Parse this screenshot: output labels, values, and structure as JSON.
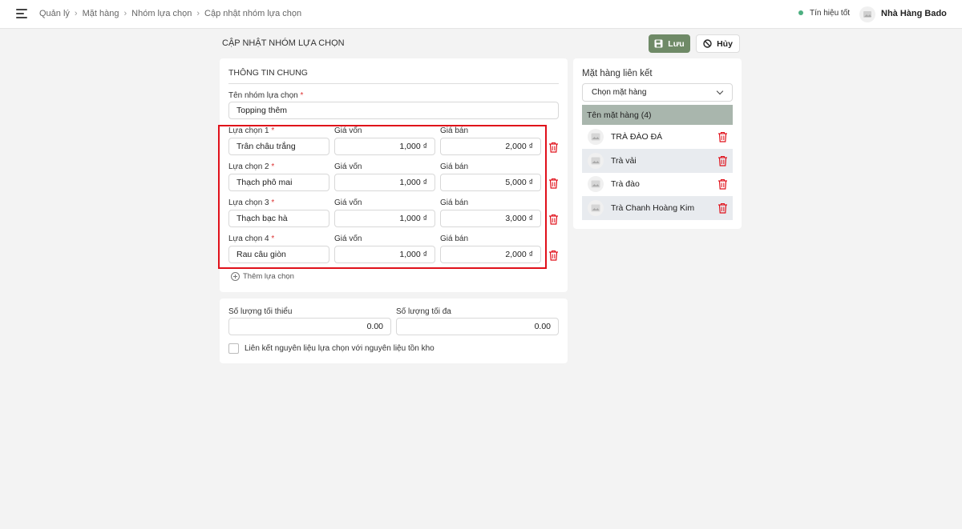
{
  "breadcrumb": [
    "Quản lý",
    "Mặt hàng",
    "Nhóm lựa chọn",
    "Cập nhật nhóm lựa chọn"
  ],
  "status_text": "Tín hiệu tốt",
  "user_name": "Nhà Hàng Bado",
  "page_title": "CẬP NHẬT NHÓM LỰA CHỌN",
  "buttons": {
    "save": "Lưu",
    "cancel": "Hủy"
  },
  "general": {
    "title": "THÔNG TIN CHUNG",
    "group_name_label": "Tên nhóm lựa chọn",
    "group_name_value": "Topping thêm",
    "required_mark": "*"
  },
  "cost_label": "Giá vốn",
  "price_label": "Giá bán",
  "choices": [
    {
      "label": "Lựa chọn 1",
      "name": "Trân châu trắng",
      "cost": "1,000 ₫",
      "price": "2,000 ₫"
    },
    {
      "label": "Lựa chọn 2",
      "name": "Thạch phô mai",
      "cost": "1,000 ₫",
      "price": "5,000 ₫"
    },
    {
      "label": "Lựa chọn 3",
      "name": "Thạch bạc hà",
      "cost": "1,000 ₫",
      "price": "3,000 ₫"
    },
    {
      "label": "Lựa chọn 4",
      "name": "Rau câu giòn",
      "cost": "1,000 ₫",
      "price": "2,000 ₫"
    }
  ],
  "add_choice": "Thêm lựa chọn",
  "quantity": {
    "min_label": "Số lượng tối thiểu",
    "min_value": "0.00",
    "max_label": "Số lượng tối đa",
    "max_value": "0.00"
  },
  "link_checkbox_label": "Liên kết nguyên liệu lựa chọn với nguyên liệu tồn kho",
  "linked": {
    "title": "Mặt hàng liên kết",
    "select_placeholder": "Chọn mặt hàng",
    "header": "Tên mặt hàng (4)",
    "items": [
      "TRÀ ĐÀO ĐÁ",
      "Trà vải",
      "Trà đào",
      "Trà Chanh Hoàng Kim"
    ]
  },
  "colors": {
    "accent": "#6f8a67",
    "danger": "#e0101a",
    "table_header": "#a9b6ad"
  }
}
